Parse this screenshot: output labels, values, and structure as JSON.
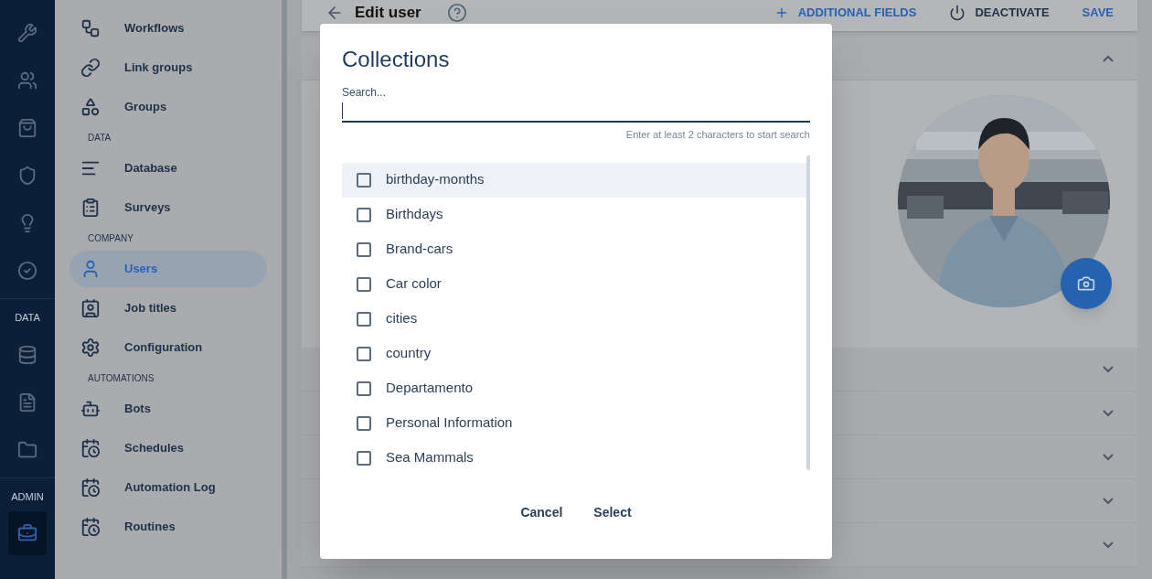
{
  "rail": [
    {
      "items": [
        {
          "selected": false
        },
        {
          "selected": false
        },
        {
          "selected": false
        },
        {
          "selected": false
        },
        {
          "selected": false
        },
        {
          "selected": false
        }
      ]
    },
    {
      "label": "DATA",
      "items": [
        {
          "selected": false
        },
        {
          "selected": false
        },
        {
          "selected": false
        }
      ]
    },
    {
      "label": "ADMIN",
      "items": [
        {
          "selected": true
        }
      ]
    }
  ],
  "sidebar": [
    {
      "items": [
        {
          "label": "Workflows",
          "selected": false
        },
        {
          "label": "Link groups",
          "selected": false
        },
        {
          "label": "Groups",
          "selected": false
        }
      ]
    },
    {
      "heading": "DATA",
      "items": [
        {
          "label": "Database",
          "selected": false
        },
        {
          "label": "Surveys",
          "selected": false
        }
      ]
    },
    {
      "heading": "COMPANY",
      "items": [
        {
          "label": "Users",
          "selected": true
        },
        {
          "label": "Job titles",
          "selected": false
        },
        {
          "label": "Configuration",
          "selected": false
        }
      ]
    },
    {
      "heading": "AUTOMATIONS",
      "items": [
        {
          "label": "Bots",
          "selected": false
        },
        {
          "label": "Schedules",
          "selected": false
        },
        {
          "label": "Automation Log",
          "selected": false
        },
        {
          "label": "Routines",
          "selected": false
        }
      ]
    }
  ],
  "topbar": {
    "title": "Edit user",
    "actions": [
      {
        "kind": "add",
        "label": "ADDITIONAL FIELDS"
      },
      {
        "kind": "power",
        "label": "DEACTIVATE"
      },
      {
        "kind": "plain",
        "label": "SAVE"
      }
    ]
  },
  "sections": [
    {
      "expanded": true
    },
    {
      "expanded": false
    },
    {
      "expanded": false
    },
    {
      "expanded": false
    },
    {
      "expanded": false
    },
    {
      "expanded": false
    }
  ],
  "dialog": {
    "title": "Collections",
    "search": {
      "label": "Search...",
      "hint": "Enter at least 2 characters to start search"
    },
    "items": [
      {
        "label": "birthday-months",
        "checked": false,
        "highlighted": true
      },
      {
        "label": "Birthdays",
        "checked": false,
        "highlighted": false
      },
      {
        "label": "Brand-cars",
        "checked": false,
        "highlighted": false
      },
      {
        "label": "Car color",
        "checked": false,
        "highlighted": false
      },
      {
        "label": "cities",
        "checked": false,
        "highlighted": false
      },
      {
        "label": "country",
        "checked": false,
        "highlighted": false
      },
      {
        "label": "Departamento",
        "checked": false,
        "highlighted": false
      },
      {
        "label": "Personal Information",
        "checked": false,
        "highlighted": false
      },
      {
        "label": "Sea Mammals",
        "checked": false,
        "highlighted": false
      }
    ],
    "buttons": [
      "Cancel",
      "Select"
    ]
  }
}
